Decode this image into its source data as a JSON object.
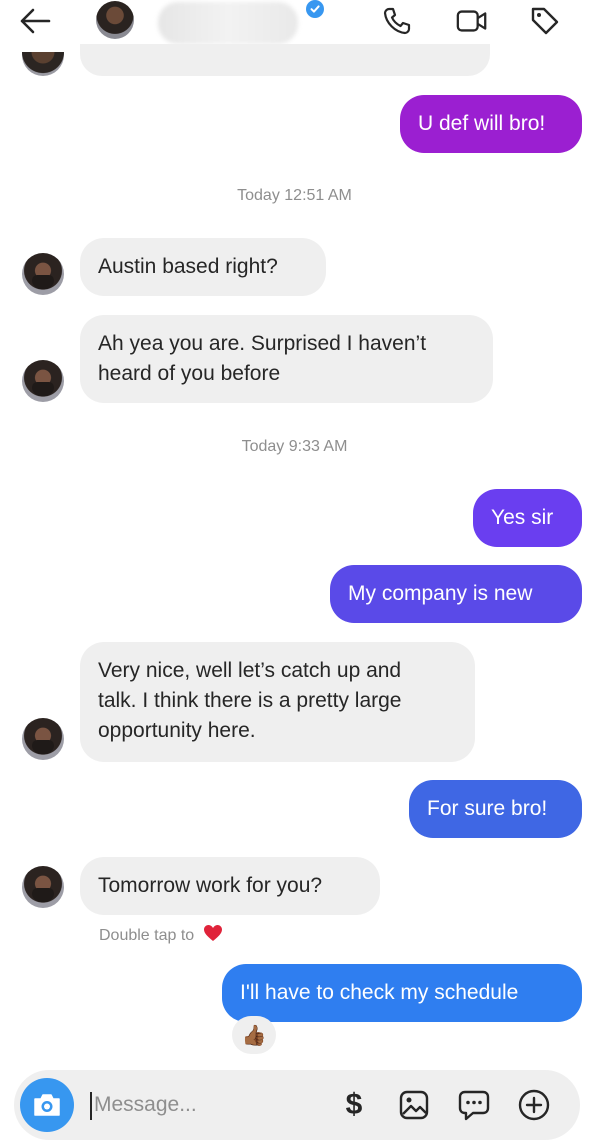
{
  "header": {
    "back_icon": "arrow-left-icon",
    "call_icon": "phone-icon",
    "video_icon": "video-camera-icon",
    "tag_icon": "tag-icon"
  },
  "colors": {
    "received_bubble": "#efefef",
    "sent_purple": "#9b1fd1",
    "sent_violet": "#6a3ef0",
    "sent_indigo": "#5a4ae8",
    "sent_blue": "#3f67e4",
    "sent_bright_blue": "#2f7ef0",
    "accent": "#3797f0"
  },
  "thread": {
    "msg_u_def": "U def will bro!",
    "ts_1": "Today 12:51 AM",
    "msg_austin": "Austin based right?",
    "msg_ah_yea_1": "Ah yea you are. Surprised I haven’t",
    "msg_ah_yea_2": "heard of you before",
    "ts_2": "Today 9:33 AM",
    "msg_yes_sir": "Yes sir",
    "msg_company": "My company is new",
    "msg_very_nice_1": "Very nice, well let’s catch up and",
    "msg_very_nice_2": "talk. I think there is a pretty large",
    "msg_very_nice_3": "opportunity here.",
    "msg_for_sure": "For sure bro!",
    "msg_tomorrow": "Tomorrow work for you?",
    "double_tap_hint": "Double tap to",
    "msg_schedule": "I'll have to check my schedule",
    "reaction_emoji": "👍🏾"
  },
  "composer": {
    "placeholder": "Message...",
    "camera_icon": "camera-icon",
    "dollar_label": "$",
    "gallery_icon": "image-icon",
    "sticker_icon": "chat-bubble-icon",
    "plus_icon": "plus-circle-icon"
  }
}
